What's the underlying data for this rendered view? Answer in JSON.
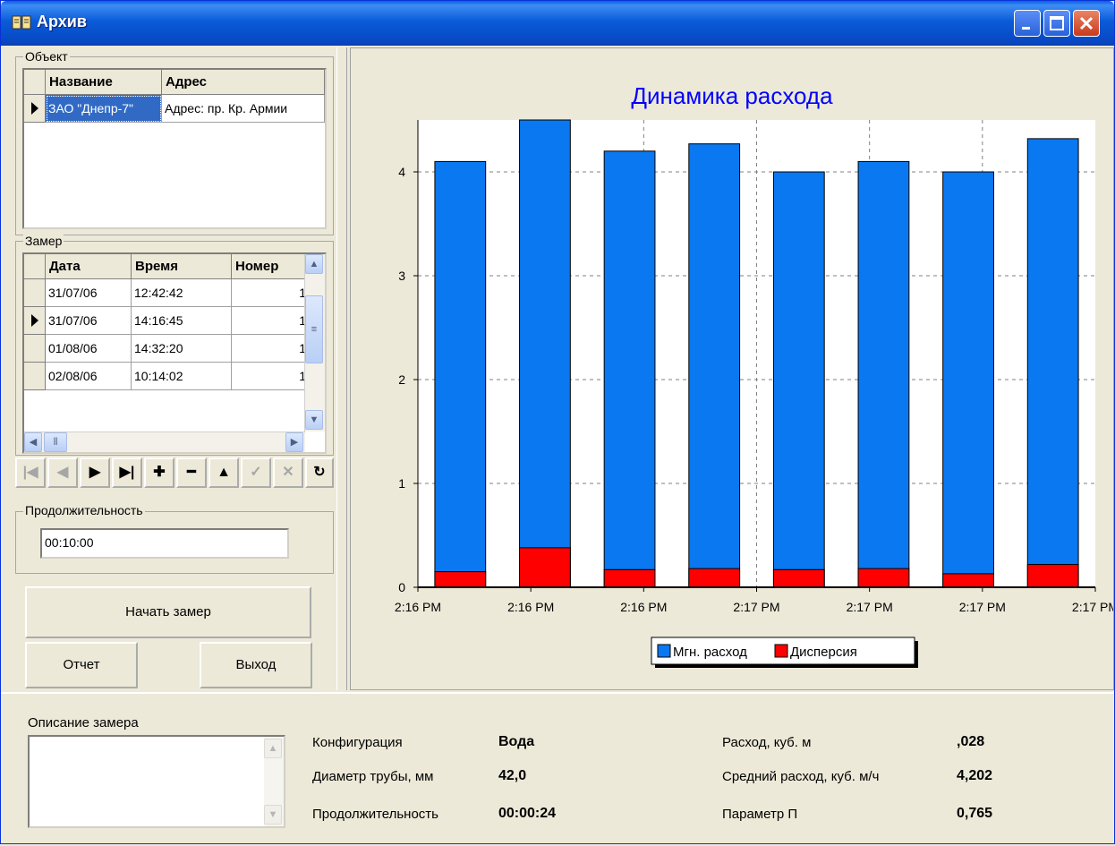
{
  "window": {
    "title": "Архив"
  },
  "object_group": {
    "label": "Объект",
    "columns": [
      "Название",
      "Адрес"
    ],
    "rows": [
      {
        "name": "ЗАО \"Днепр-7\"",
        "address": "Адрес: пр. Кр. Армии"
      }
    ]
  },
  "zamer_group": {
    "label": "Замер",
    "columns": [
      "Дата",
      "Время",
      "Номер"
    ],
    "rows": [
      {
        "date": "31/07/06",
        "time": "12:42:42",
        "num": "1"
      },
      {
        "date": "31/07/06",
        "time": "14:16:45",
        "num": "1"
      },
      {
        "date": "01/08/06",
        "time": "14:32:20",
        "num": "1"
      },
      {
        "date": "02/08/06",
        "time": "10:14:02",
        "num": "1"
      }
    ]
  },
  "duration_group": {
    "label": "Продолжительность",
    "value": "00:10:00"
  },
  "buttons": {
    "start": "Начать замер",
    "report": "Отчет",
    "exit": "Выход"
  },
  "chart_data": {
    "type": "bar",
    "title": "Динамика расхода",
    "categories": [
      "2:16 PM",
      "2:16 PM",
      "2:16 PM",
      "2:17 PM",
      "2:17 PM",
      "2:17 PM",
      "2:17 PM"
    ],
    "x_tick_labels": [
      "2:16 PM",
      "2:16 PM",
      "2:16 PM",
      "2:17 PM",
      "2:17 PM",
      "2:17 PM",
      "2:17 PM"
    ],
    "series": [
      {
        "name": "Мгн. расход",
        "color": "#0a78f0",
        "values": [
          4.1,
          4.5,
          4.2,
          4.27,
          4.0,
          4.1,
          4.0,
          4.32
        ]
      },
      {
        "name": "Дисперсия",
        "color": "#ff0000",
        "values": [
          0.15,
          0.38,
          0.17,
          0.18,
          0.17,
          0.18,
          0.13,
          0.22
        ]
      }
    ],
    "ylim": [
      0,
      4.5
    ],
    "y_ticks": [
      0,
      1,
      2,
      3,
      4
    ],
    "grid": true,
    "legend": "bottom-center"
  },
  "description": {
    "label": "Описание замера",
    "config_label": "Конфигурация",
    "config_value": "Вода",
    "diameter_label": "Диаметр трубы, мм",
    "diameter_value": "42,0",
    "duration_label": "Продолжительность",
    "duration_value": "00:00:24",
    "flow_label": "Расход, куб. м",
    "flow_value": ",028",
    "avg_label": "Средний расход, куб. м/ч",
    "avg_value": "4,202",
    "param_label": "Параметр П",
    "param_value": "0,765"
  }
}
